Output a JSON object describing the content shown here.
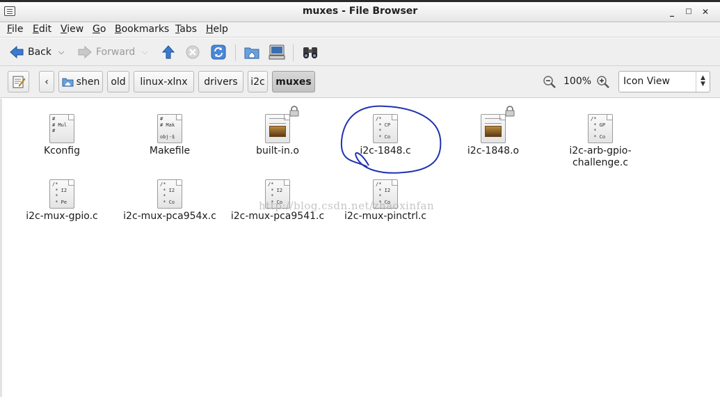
{
  "window": {
    "title": "muxes - File Browser"
  },
  "menu": [
    {
      "key": "F",
      "rest": "ile"
    },
    {
      "key": "E",
      "rest": "dit"
    },
    {
      "key": "V",
      "rest": "iew"
    },
    {
      "key": "G",
      "rest": "o"
    },
    {
      "key": "B",
      "rest": "ookmarks"
    },
    {
      "key": "T",
      "rest": "abs"
    },
    {
      "key": "H",
      "rest": "elp"
    }
  ],
  "toolbar": {
    "back_label": "Back",
    "forward_label": "Forward"
  },
  "path": [
    "shen",
    "old",
    "linux-xlnx",
    "drivers",
    "i2c",
    "muxes"
  ],
  "zoom": {
    "level": "100%"
  },
  "view_mode": "Icon View",
  "files": [
    {
      "name": "Kconfig",
      "snippet": "#\n# Mul\n#"
    },
    {
      "name": "Makefile",
      "snippet": "#\n# Mak\n\nobj-$"
    },
    {
      "name": "built-in.o",
      "snippet": ""
    },
    {
      "name": "i2c-1848.c",
      "snippet": "/*\n * CP\n *\n * Co"
    },
    {
      "name": "i2c-1848.o",
      "snippet": ""
    },
    {
      "name": "i2c-arb-gpio-challenge.c",
      "name_line1": "i2c-arb-gpio-",
      "name_line2": "challenge.c",
      "snippet": "/*\n * GP\n *\n * Co"
    },
    {
      "name": "i2c-mux-gpio.c",
      "snippet": "/*\n * I2\n *\n * Pe"
    },
    {
      "name": "i2c-mux-pca954x.c",
      "snippet": "/*\n * I2\n *\n * Co"
    },
    {
      "name": "i2c-mux-pca9541.c",
      "snippet": "/*\n * I2\n *\n * Co"
    },
    {
      "name": "i2c-mux-pinctrl.c",
      "snippet": "/*\n * I2\n *\n * Co"
    }
  ],
  "watermark": "http://blog.csdn.net/zhaoxinfan"
}
